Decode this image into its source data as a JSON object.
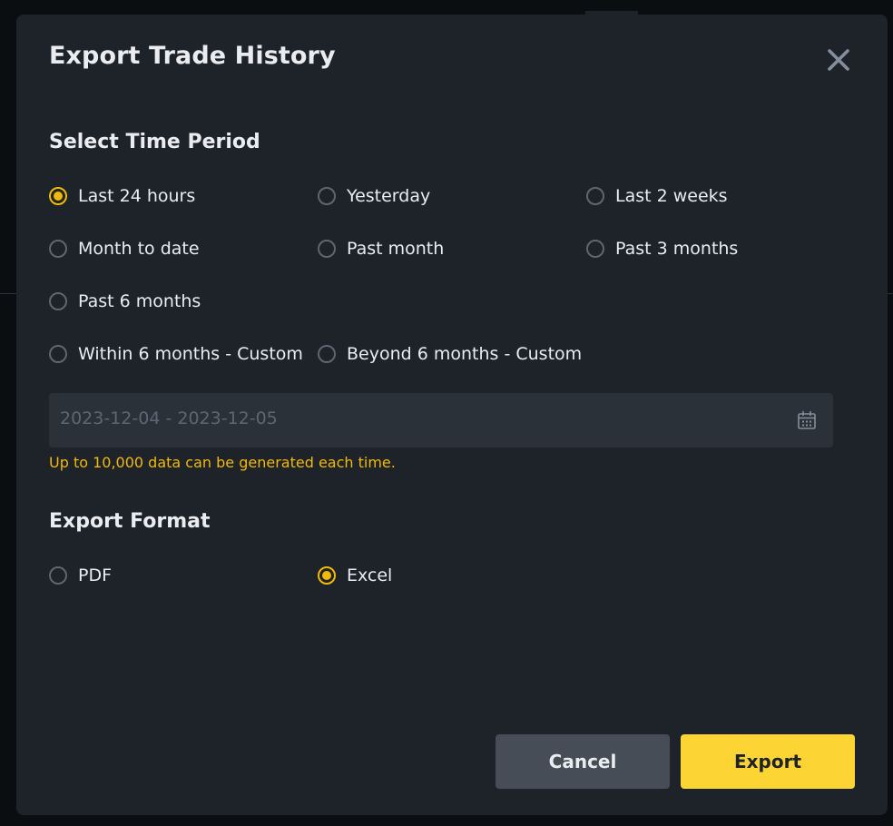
{
  "dialog": {
    "title": "Export Trade History",
    "close_icon": "close-icon"
  },
  "time_period": {
    "heading": "Select Time Period",
    "options": [
      {
        "label": "Last 24 hours",
        "checked": true
      },
      {
        "label": "Yesterday",
        "checked": false
      },
      {
        "label": "Last 2 weeks",
        "checked": false
      },
      {
        "label": "Month to date",
        "checked": false
      },
      {
        "label": "Past month",
        "checked": false
      },
      {
        "label": "Past 3 months",
        "checked": false
      },
      {
        "label": "Past 6 months",
        "checked": false
      },
      {
        "label": "Within 6 months - Custom",
        "checked": false
      },
      {
        "label": "Beyond 6 months - Custom",
        "checked": false
      }
    ],
    "date_range": {
      "value": "2023-12-04 - 2023-12-05",
      "icon": "calendar-icon"
    },
    "notice": "Up to 10,000 data can be generated each time."
  },
  "export_format": {
    "heading": "Export Format",
    "options": [
      {
        "label": "PDF",
        "checked": false
      },
      {
        "label": "Excel",
        "checked": true
      }
    ]
  },
  "actions": {
    "cancel_label": "Cancel",
    "export_label": "Export"
  },
  "colors": {
    "accent": "#f0b90b",
    "primary_button": "#fcd535",
    "dialog_background": "#1e2329",
    "secondary_button": "#474d57"
  }
}
